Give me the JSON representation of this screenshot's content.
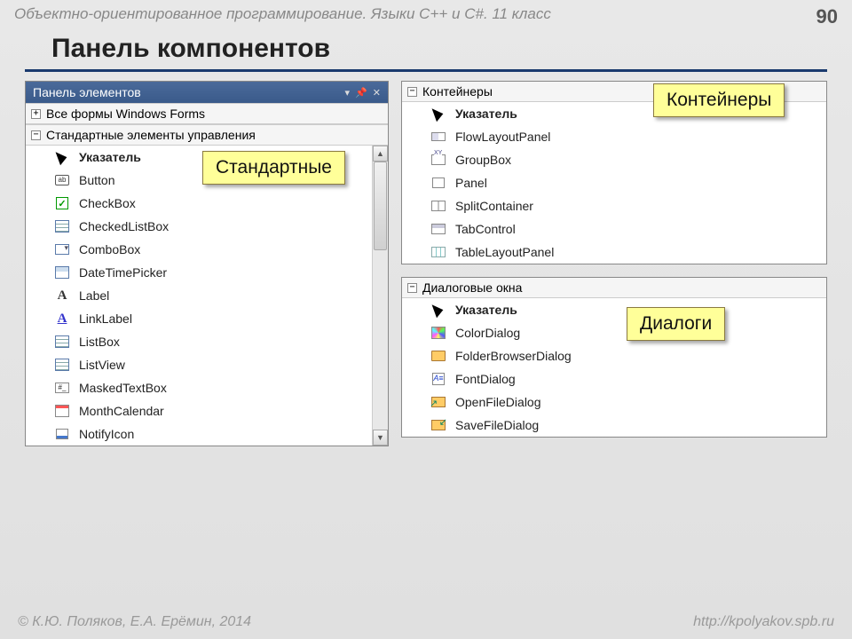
{
  "header": {
    "course": "Объектно-ориентированное программирование. Языки C++ и C#. 11 класс",
    "page": "90"
  },
  "title": "Панель компонентов",
  "left_panel": {
    "title": "Панель элементов",
    "cat_all": "Все формы Windows Forms",
    "cat_std": "Стандартные элементы управления",
    "items": [
      {
        "label": "Указатель",
        "icon": "cursor",
        "bold": true
      },
      {
        "label": "Button",
        "icon": "box-ab"
      },
      {
        "label": "CheckBox",
        "icon": "check"
      },
      {
        "label": "CheckedListBox",
        "icon": "list"
      },
      {
        "label": "ComboBox",
        "icon": "combo"
      },
      {
        "label": "DateTimePicker",
        "icon": "grid"
      },
      {
        "label": "Label",
        "icon": "A"
      },
      {
        "label": "LinkLabel",
        "icon": "Au"
      },
      {
        "label": "ListBox",
        "icon": "list"
      },
      {
        "label": "ListView",
        "icon": "list"
      },
      {
        "label": "MaskedTextBox",
        "icon": "mask"
      },
      {
        "label": "MonthCalendar",
        "icon": "cal"
      },
      {
        "label": "NotifyIcon",
        "icon": "notify"
      }
    ]
  },
  "containers": {
    "title": "Контейнеры",
    "items": [
      {
        "label": "Указатель",
        "icon": "cursor",
        "bold": true
      },
      {
        "label": "FlowLayoutPanel",
        "icon": "flow"
      },
      {
        "label": "GroupBox",
        "icon": "group"
      },
      {
        "label": "Panel",
        "icon": "panel"
      },
      {
        "label": "SplitContainer",
        "icon": "split"
      },
      {
        "label": "TabControl",
        "icon": "tab"
      },
      {
        "label": "TableLayoutPanel",
        "icon": "tlp"
      }
    ]
  },
  "dialogs": {
    "title": "Диалоговые окна",
    "items": [
      {
        "label": "Указатель",
        "icon": "cursor",
        "bold": true
      },
      {
        "label": "ColorDialog",
        "icon": "color"
      },
      {
        "label": "FolderBrowserDialog",
        "icon": "folder"
      },
      {
        "label": "FontDialog",
        "icon": "font"
      },
      {
        "label": "OpenFileDialog",
        "icon": "open"
      },
      {
        "label": "SaveFileDialog",
        "icon": "save"
      }
    ]
  },
  "callouts": {
    "std": "Стандартные",
    "cont": "Контейнеры",
    "dlg": "Диалоги"
  },
  "footer": {
    "copyright": "© К.Ю. Поляков, Е.А. Ерёмин, 2014",
    "url": "http://kpolyakov.spb.ru"
  }
}
